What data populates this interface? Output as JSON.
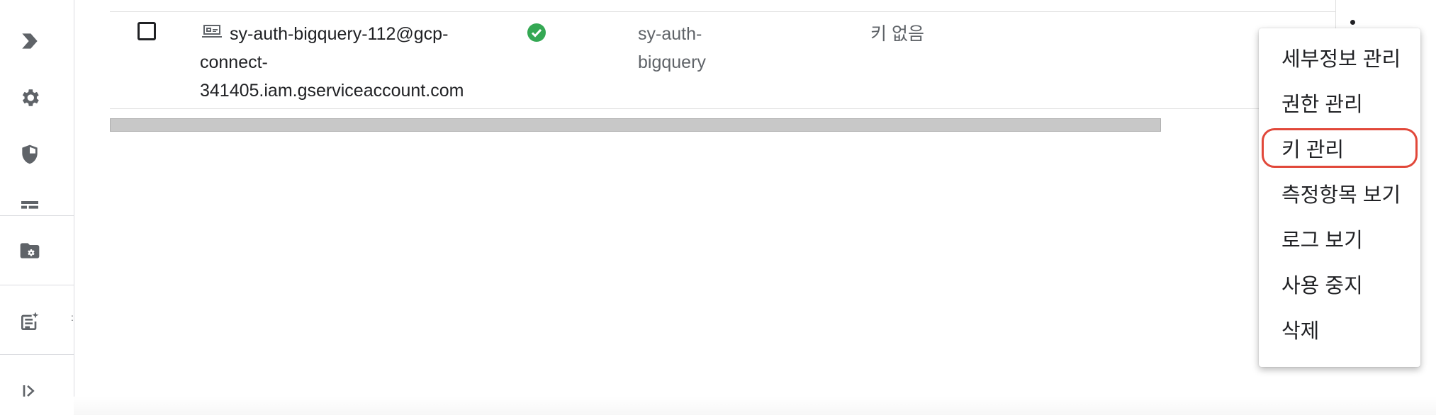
{
  "nav": {
    "icons": [
      "chevron-right-icon",
      "gear-icon",
      "shield-icon",
      "list-icon",
      "folder-gear-icon",
      "notes-icon",
      "expand-icon"
    ]
  },
  "row": {
    "email_parts": [
      "sy-auth-bigquery-112@gcp-",
      "connect-",
      "341405.iam.gserviceaccount.com"
    ],
    "status": "enabled",
    "name_parts": [
      "sy-auth-",
      "bigquery"
    ],
    "keys": "키 없음"
  },
  "menu": {
    "items": [
      "세부정보 관리",
      "권한 관리",
      "키 관리",
      "측정항목 보기",
      "로그 보기",
      "사용 중지",
      "삭제"
    ],
    "highlighted": "키 관리"
  },
  "colors": {
    "status_ok": "#34a853",
    "highlight": "#e1483a"
  }
}
